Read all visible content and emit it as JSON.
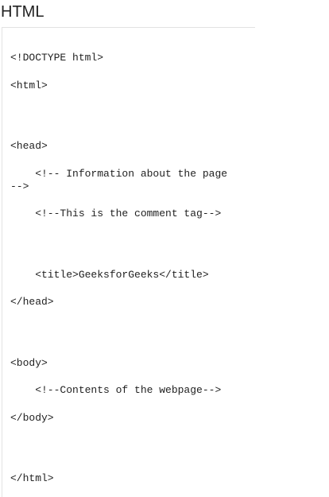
{
  "heading": "HTML",
  "code_lines": [
    "<!DOCTYPE html>",
    "<html>",
    "<head>",
    "    <!-- Information about the page",
    "-->",
    "    <!--This is the comment tag-->",
    "    <title>GeeksforGeeks</title>",
    "</head>",
    "<body>",
    "    <!--Contents of the webpage-->",
    "</body>",
    "</html>"
  ]
}
